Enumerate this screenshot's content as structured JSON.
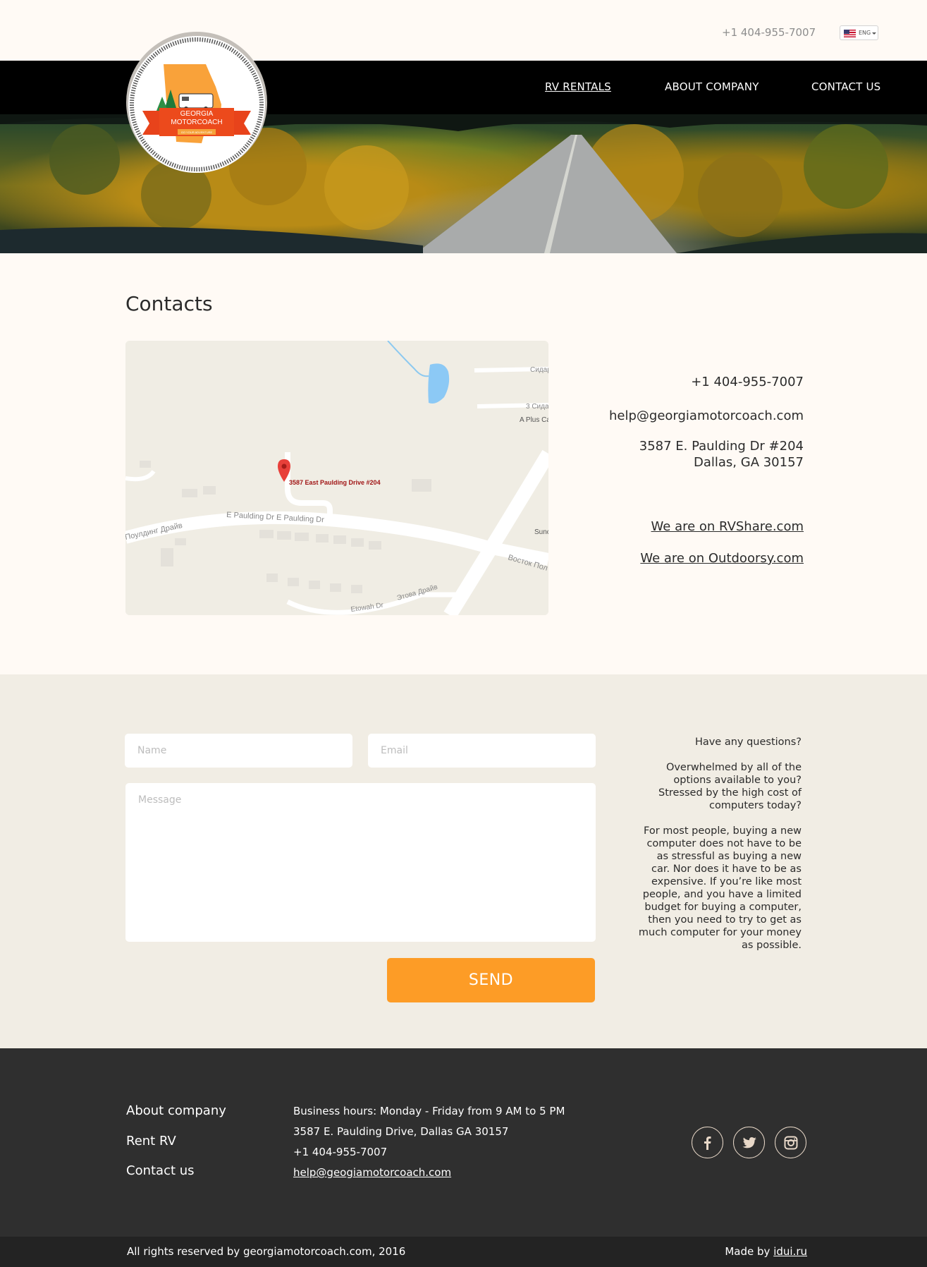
{
  "header": {
    "phone": "+1 404-955-7007",
    "language": "ENG",
    "logo": {
      "line1": "GEORGIA",
      "line2": "MOTORCOACH",
      "tagline": "GO YOUR ADVENTURE"
    },
    "nav": [
      {
        "label": "RV RENTALS",
        "active": true
      },
      {
        "label": "ABOUT COMPANY",
        "active": false
      },
      {
        "label": "CONTACT US",
        "active": false
      }
    ]
  },
  "contacts": {
    "title": "Contacts",
    "phone": "+1 404-955-7007",
    "email": "help@georgiamotorcoach.com",
    "address_line1": "3587 E. Paulding Dr #204",
    "address_line2": "Dallas, GA 30157",
    "link_rvshare": "We are on RVShare.com",
    "link_outdoorsy": "We are on Outdoorsy.com"
  },
  "map": {
    "marker_label": "3587  East Paulding Drive #204",
    "labels": {
      "sidar1": "Сидар",
      "sidar3": "3 Сида",
      "aplus": "A Plus Ca",
      "sunc": "Sunc",
      "vostok": "Восток Пол",
      "paulding_ru": "t Поулдинг Драйв",
      "paulding_en": "E Paulding Dr E Paulding Dr",
      "etowah_ru": "Этова Драйв",
      "etowah_en": "Etowah Dr"
    }
  },
  "form": {
    "name_placeholder": "Name",
    "email_placeholder": "Email",
    "message_placeholder": "Message",
    "send_label": "SEND",
    "side_q": "Have any questions?",
    "side_p1": "Overwhelmed by all of the options available to you? Stressed by the high cost of computers today?",
    "side_p2": "For most people, buying a new computer does not have to be as stressful as buying a new car. Nor does it have to be as expensive. If you’re like most people, and you have a limited budget for buying a computer, then you need to try to get as much computer for your money as possible."
  },
  "footer": {
    "nav": [
      "About company",
      "Rent RV",
      "Contact us"
    ],
    "hours": "Business hours: Monday - Friday from 9 AM to 5 PM",
    "address": "3587 E. Paulding Drive, Dallas GA 30157",
    "phone": "+1 404-955-7007",
    "email": "help@geogiamotorcoach.com",
    "social": [
      "facebook-icon",
      "twitter-icon",
      "instagram-icon"
    ],
    "copyright": "All rights reserved by georgiamotorcoach.com, 2016",
    "made_by_prefix": "Made by ",
    "made_by_link": "idui.ru"
  }
}
